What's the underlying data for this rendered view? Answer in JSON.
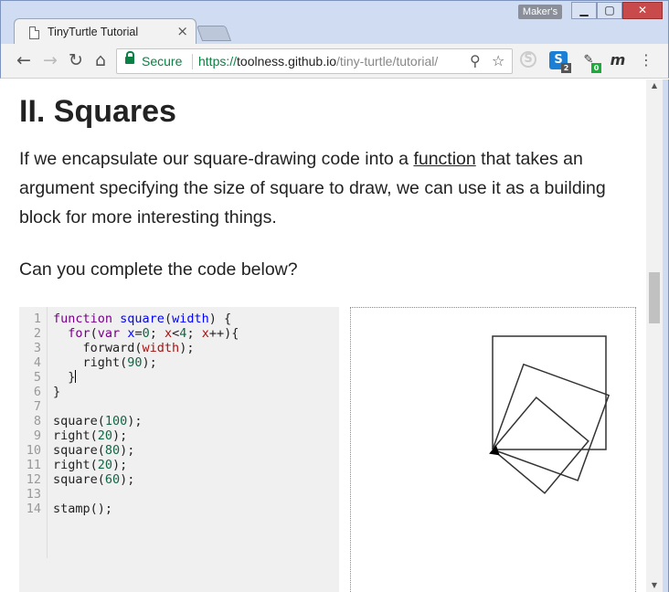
{
  "window": {
    "tab_title": "TinyTurtle Tutorial",
    "tab_close": "×",
    "profile_label": "Maker's",
    "min_icon": "▁",
    "max_icon": "▢",
    "close_icon": "✕"
  },
  "toolbar": {
    "back": "←",
    "forward": "→",
    "reload": "↻",
    "home": "⌂",
    "secure_label": "Secure",
    "url_scheme": "https://",
    "url_host": "toolness.github.io",
    "url_path": "/tiny-turtle/tutorial/",
    "zoom_icon": "⚲",
    "star_icon": "☆",
    "ext_skype": "S",
    "ext_s": "S",
    "ext_s_badge": "2",
    "ext_pen": "✎",
    "ext_pen_badge": "0",
    "ext_m": "m",
    "menu": "⋮"
  },
  "page": {
    "heading": "II. Squares",
    "para1_before": "If we encapsulate our square-drawing code into a ",
    "para1_link": "function",
    "para1_after": " that takes an argument specifying the size of square to draw, we can use it as a building block for more interesting things.",
    "para2": "Can you complete the code below?"
  },
  "code": {
    "line_numbers": [
      "1",
      "2",
      "3",
      "4",
      "5",
      "6",
      "7",
      "8",
      "9",
      "10",
      "11",
      "12",
      "13",
      "14"
    ],
    "lines": [
      [
        {
          "t": "kw",
          "v": "function"
        },
        {
          "t": "",
          "v": " "
        },
        {
          "t": "def",
          "v": "square"
        },
        {
          "t": "",
          "v": "("
        },
        {
          "t": "def",
          "v": "width"
        },
        {
          "t": "",
          "v": ") {"
        }
      ],
      [
        {
          "t": "",
          "v": "  "
        },
        {
          "t": "kw",
          "v": "for"
        },
        {
          "t": "",
          "v": "("
        },
        {
          "t": "kw",
          "v": "var"
        },
        {
          "t": "",
          "v": " "
        },
        {
          "t": "def",
          "v": "x"
        },
        {
          "t": "",
          "v": "="
        },
        {
          "t": "num",
          "v": "0"
        },
        {
          "t": "",
          "v": "; "
        },
        {
          "t": "var",
          "v": "x"
        },
        {
          "t": "",
          "v": "<"
        },
        {
          "t": "num",
          "v": "4"
        },
        {
          "t": "",
          "v": "; "
        },
        {
          "t": "var",
          "v": "x"
        },
        {
          "t": "",
          "v": "++){"
        }
      ],
      [
        {
          "t": "",
          "v": "    forward("
        },
        {
          "t": "var",
          "v": "width"
        },
        {
          "t": "",
          "v": ");"
        }
      ],
      [
        {
          "t": "",
          "v": "    right("
        },
        {
          "t": "num",
          "v": "90"
        },
        {
          "t": "",
          "v": ");"
        }
      ],
      [
        {
          "t": "",
          "v": "  }"
        }
      ],
      [
        {
          "t": "",
          "v": "}"
        }
      ],
      [],
      [
        {
          "t": "",
          "v": "square("
        },
        {
          "t": "num",
          "v": "100"
        },
        {
          "t": "",
          "v": ");"
        }
      ],
      [
        {
          "t": "",
          "v": "right("
        },
        {
          "t": "num",
          "v": "20"
        },
        {
          "t": "",
          "v": ");"
        }
      ],
      [
        {
          "t": "",
          "v": "square("
        },
        {
          "t": "num",
          "v": "80"
        },
        {
          "t": "",
          "v": ");"
        }
      ],
      [
        {
          "t": "",
          "v": "right("
        },
        {
          "t": "num",
          "v": "20"
        },
        {
          "t": "",
          "v": ");"
        }
      ],
      [
        {
          "t": "",
          "v": "square("
        },
        {
          "t": "num",
          "v": "60"
        },
        {
          "t": "",
          "v": ");"
        }
      ],
      [],
      [
        {
          "t": "",
          "v": "stamp();"
        }
      ]
    ],
    "cursor_line": 5
  },
  "turtle_output": {
    "stroke_color": "#333333",
    "squares": [
      {
        "size": 100,
        "heading_deg": 0
      },
      {
        "size": 80,
        "heading_deg": 20
      },
      {
        "size": 60,
        "heading_deg": 40
      }
    ]
  }
}
